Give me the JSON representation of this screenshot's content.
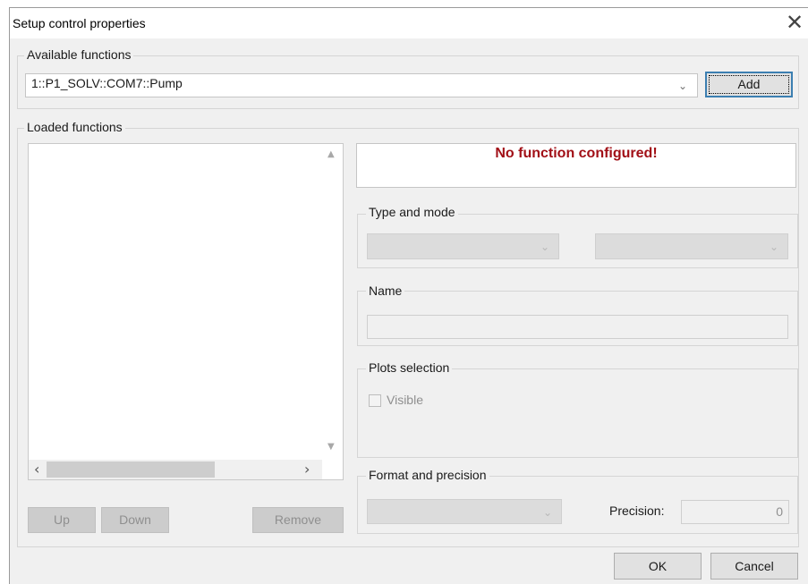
{
  "window": {
    "title": "Setup control properties",
    "close_glyph": "✕"
  },
  "available": {
    "legend": "Available functions",
    "selected": "1::P1_SOLV::COM7::Pump",
    "add_label": "Add"
  },
  "loaded": {
    "legend": "Loaded functions",
    "items": [],
    "up_label": "Up",
    "down_label": "Down",
    "remove_label": "Remove"
  },
  "details": {
    "status": "No function configured!",
    "status_color": "#a10f16",
    "type_mode_legend": "Type and mode",
    "type_value": "",
    "mode_value": "",
    "name_legend": "Name",
    "name_value": "",
    "plots_legend": "Plots selection",
    "visible_label": "Visible",
    "visible_checked": false,
    "format_legend": "Format and precision",
    "format_value": "",
    "precision_label": "Precision:",
    "precision_value": "0"
  },
  "footer": {
    "ok_label": "OK",
    "cancel_label": "Cancel"
  }
}
